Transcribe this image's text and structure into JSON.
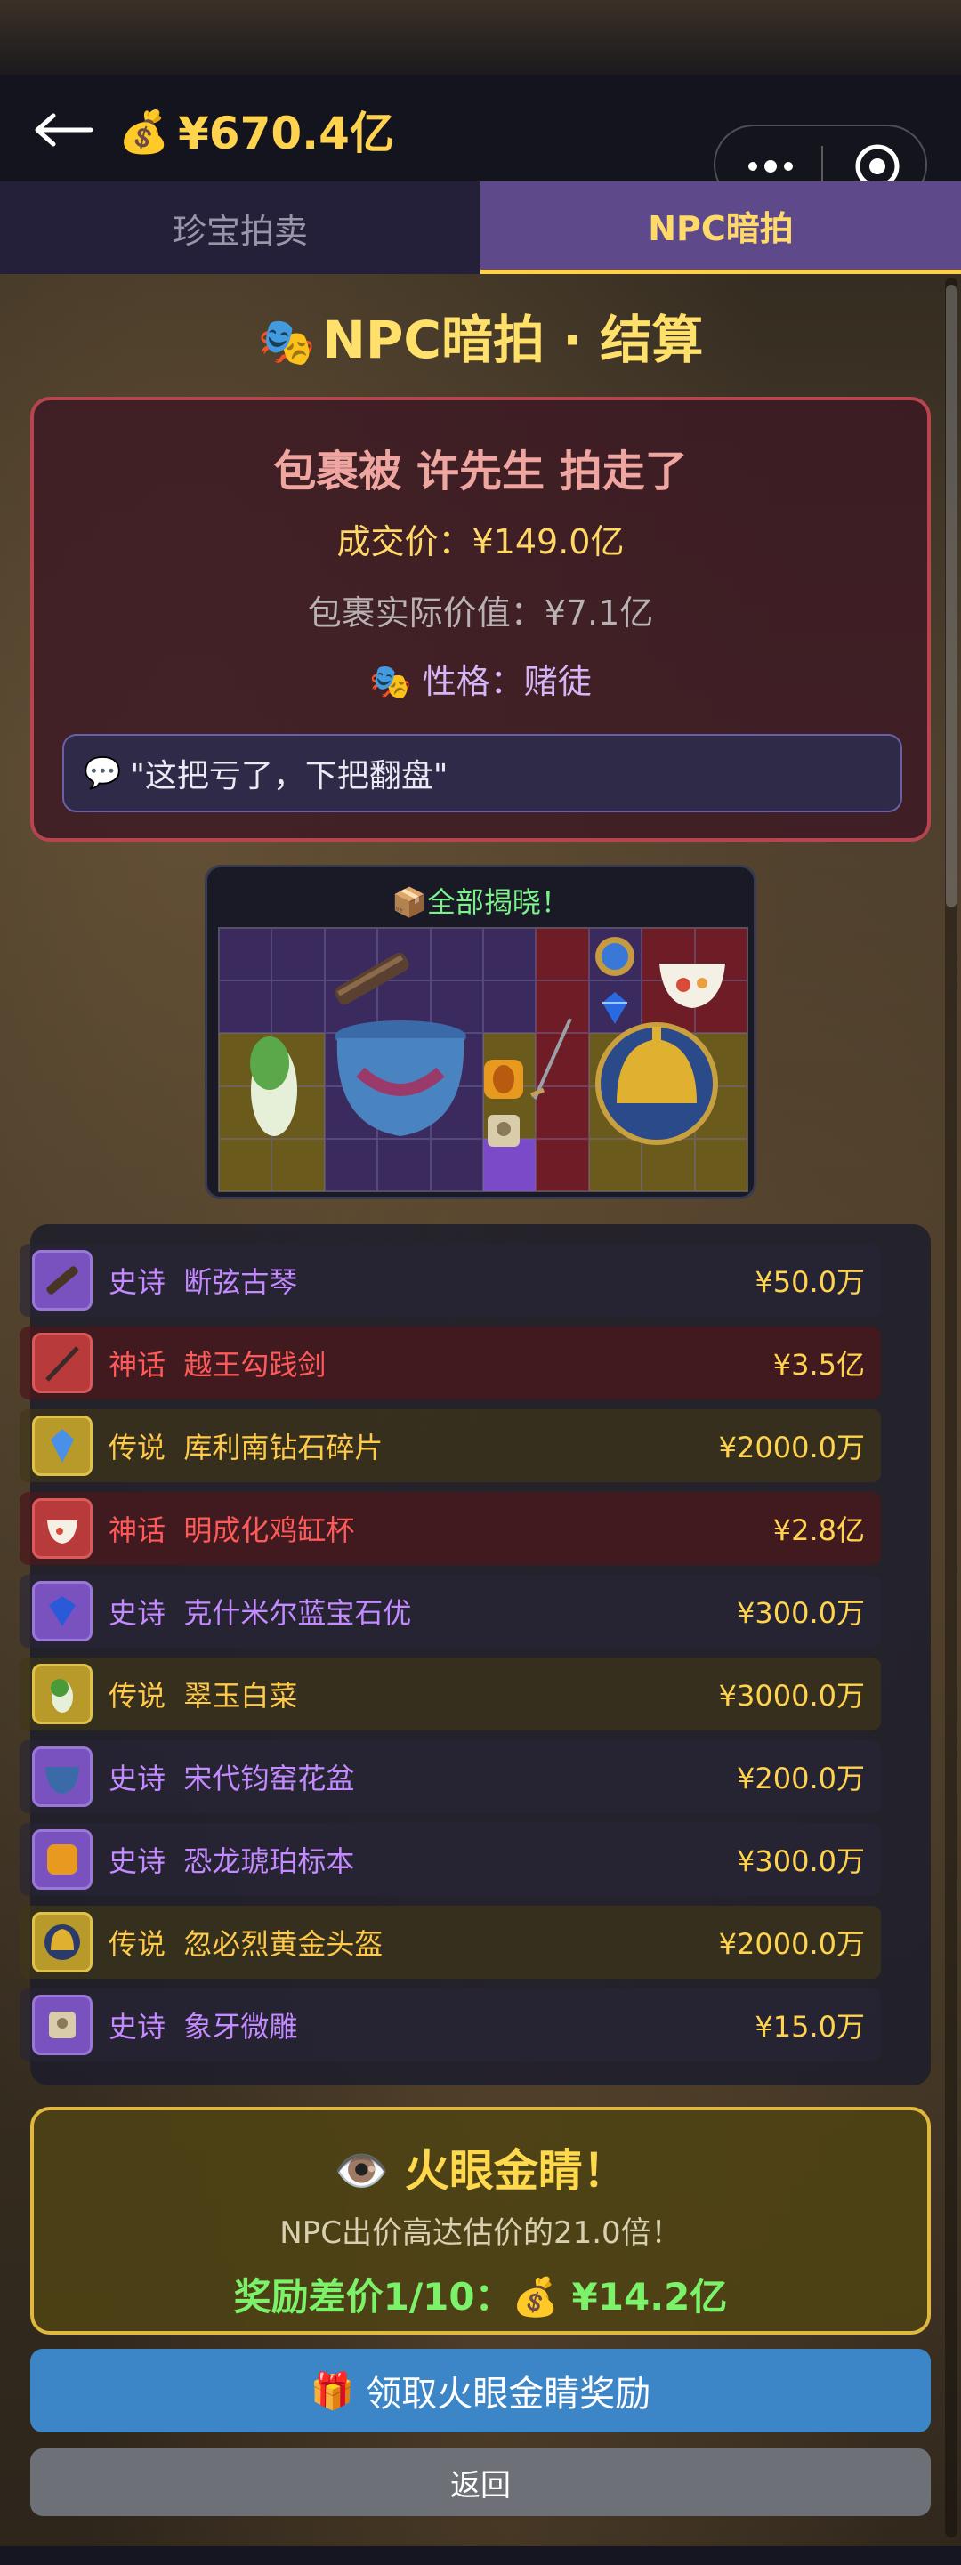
{
  "header": {
    "balance": "¥670.4亿",
    "coin_icon": "💰"
  },
  "tabs": [
    {
      "label": "珍宝拍卖",
      "active": false
    },
    {
      "label": "NPC暗拍",
      "active": true
    }
  ],
  "section": {
    "title": "NPC暗拍 · 结算",
    "icon": "🎭"
  },
  "settlement": {
    "headline": "包裹被 许先生 拍走了",
    "deal_price": "成交价：¥149.0亿",
    "real_value": "包裹实际价值：¥7.1亿",
    "trait": "性格：赌徒",
    "trait_icon": "🎭",
    "quote_icon": "💬",
    "quote": "\"这把亏了，下把翻盘\""
  },
  "reveal": {
    "icon": "📦",
    "label": "全部揭晓！"
  },
  "items": [
    {
      "rarity": "史诗",
      "name": "断弦古琴",
      "value": "¥50.0万",
      "tier": "epic",
      "icon": "guqin-icon"
    },
    {
      "rarity": "神话",
      "name": "越王勾践剑",
      "value": "¥3.5亿",
      "tier": "myth",
      "icon": "sword-icon"
    },
    {
      "rarity": "传说",
      "name": "库利南钻石碎片",
      "value": "¥2000.0万",
      "tier": "legend",
      "icon": "diamond-icon"
    },
    {
      "rarity": "神话",
      "name": "明成化鸡缸杯",
      "value": "¥2.8亿",
      "tier": "myth",
      "icon": "cup-icon"
    },
    {
      "rarity": "史诗",
      "name": "克什米尔蓝宝石优",
      "value": "¥300.0万",
      "tier": "epic",
      "icon": "sapphire-icon"
    },
    {
      "rarity": "传说",
      "name": "翠玉白菜",
      "value": "¥3000.0万",
      "tier": "legend",
      "icon": "cabbage-icon"
    },
    {
      "rarity": "史诗",
      "name": "宋代钧窑花盆",
      "value": "¥200.0万",
      "tier": "epic",
      "icon": "pot-icon"
    },
    {
      "rarity": "史诗",
      "name": "恐龙琥珀标本",
      "value": "¥300.0万",
      "tier": "epic",
      "icon": "amber-icon"
    },
    {
      "rarity": "传说",
      "name": "忽必烈黄金头盔",
      "value": "¥2000.0万",
      "tier": "legend",
      "icon": "helmet-icon"
    },
    {
      "rarity": "史诗",
      "name": "象牙微雕",
      "value": "¥15.0万",
      "tier": "epic",
      "icon": "carving-icon"
    }
  ],
  "eye_card": {
    "icon": "👁️",
    "title": "火眼金睛！",
    "desc": "NPC出价高达估价的21.0倍！",
    "reward_prefix": "奖励差价1/10：",
    "reward_icon": "💰",
    "reward_value": "¥14.2亿"
  },
  "buttons": {
    "claim_icon": "🎁",
    "claim": "领取火眼金睛奖励",
    "back": "返回"
  },
  "colors": {
    "epic": "#c48aff",
    "myth": "#ff5a5a",
    "legend": "#ffca4a",
    "gold": "#ffd34d",
    "green": "#7cf26a"
  }
}
